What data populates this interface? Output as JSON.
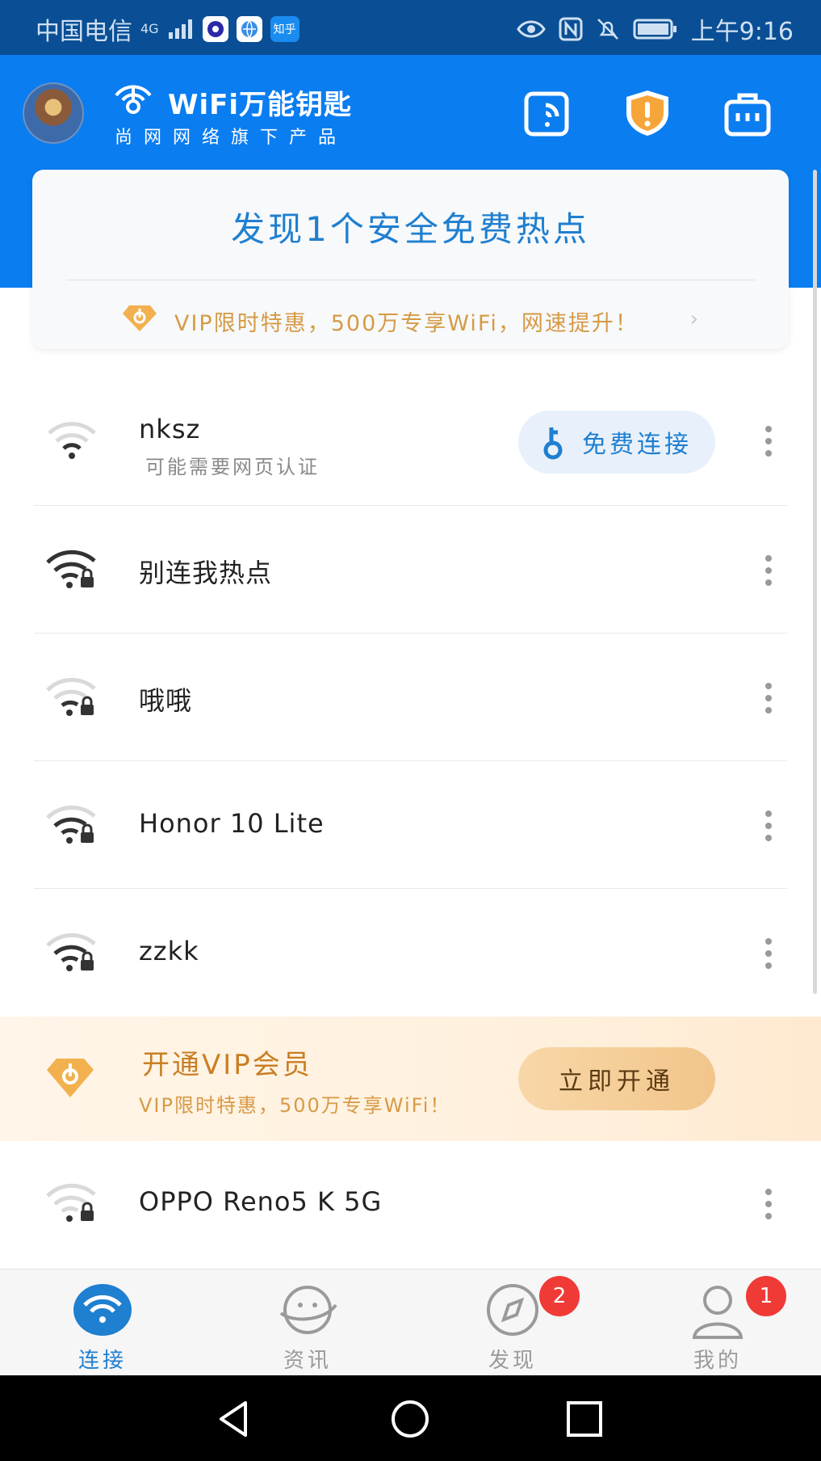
{
  "status_bar": {
    "carrier": "中国电信",
    "network": "4G",
    "zhihu_badge": "知乎",
    "time": "上午9:16"
  },
  "header": {
    "brand_title": "WiFi万能钥匙",
    "brand_subtitle": "尚网网络旗下产品",
    "icons": [
      "signal-share-icon",
      "shield-icon",
      "toolbox-icon"
    ]
  },
  "card": {
    "title": "发现1个安全免费热点",
    "promo": "VIP限时特惠，500万专享WiFi，网速提升！"
  },
  "networks": [
    {
      "name": "nksz",
      "subtitle": "可能需要网页认证",
      "locked": false,
      "action": "免费连接"
    },
    {
      "name": "别连我热点",
      "locked": true
    },
    {
      "name": "哦哦",
      "locked": true
    },
    {
      "name": "Honor 10 Lite",
      "locked": true
    },
    {
      "name": "zzkk",
      "locked": true
    },
    {
      "name": "OPPO Reno5 K 5G",
      "locked": true
    }
  ],
  "vip_banner": {
    "title": "开通VIP会员",
    "subtitle": "VIP限时特惠，500万专享WiFi！",
    "button": "立即开通"
  },
  "bottom_nav": [
    {
      "label": "连接",
      "icon": "wifi-icon",
      "active": true
    },
    {
      "label": "资讯",
      "icon": "planet-icon",
      "active": false
    },
    {
      "label": "发现",
      "icon": "compass-icon",
      "active": false,
      "badge": "2"
    },
    {
      "label": "我的",
      "icon": "person-icon",
      "active": false,
      "badge": "1"
    }
  ],
  "colors": {
    "status_bar": "#0a4f95",
    "header": "#0a7df0",
    "accent": "#1f7fd0",
    "vip_gold": "#d69a45",
    "badge_red": "#f03a36"
  }
}
